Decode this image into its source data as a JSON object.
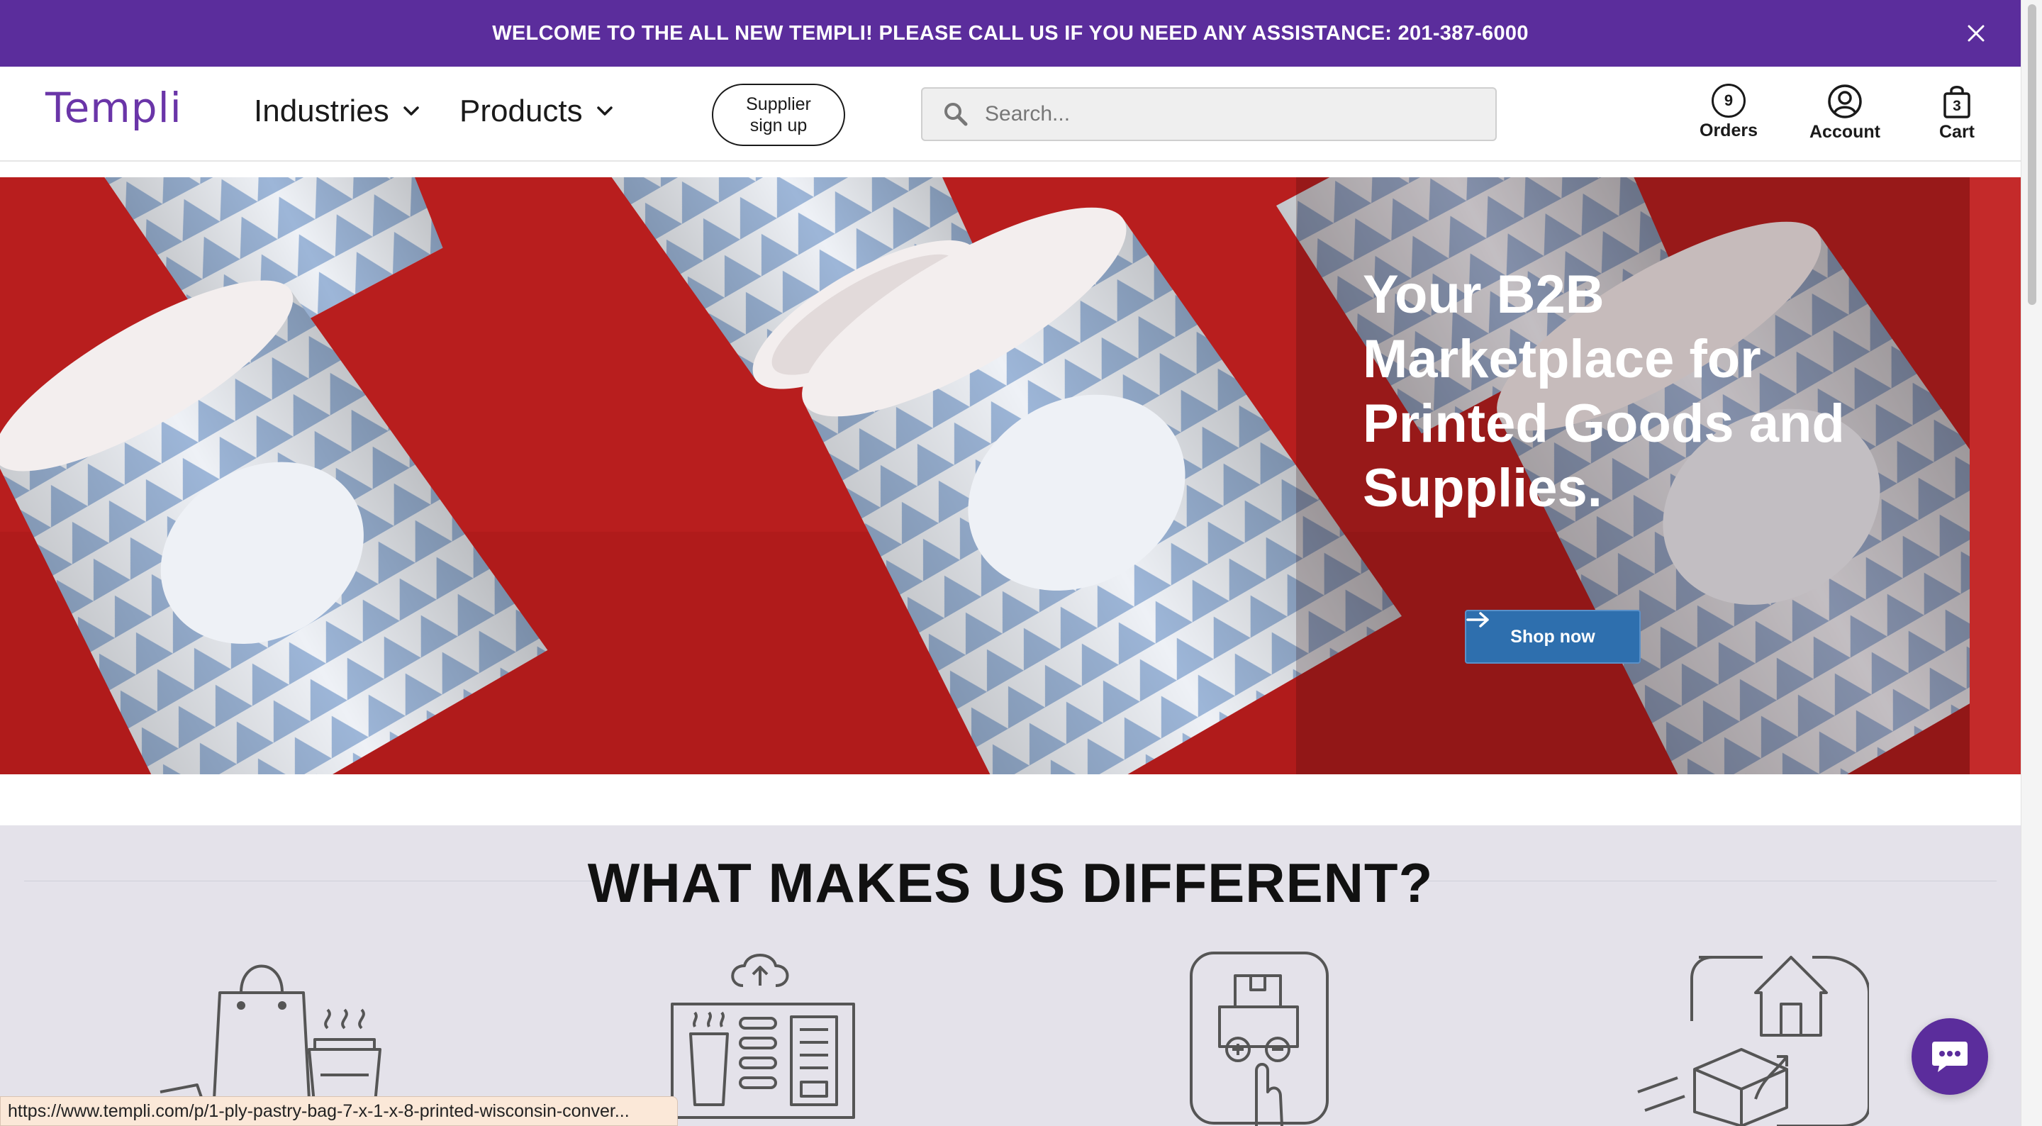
{
  "announcement": {
    "text": "WELCOME TO THE ALL NEW TEMPLI! PLEASE CALL US IF YOU NEED ANY ASSISTANCE: 201-387-6000",
    "close_icon": "close-icon"
  },
  "header": {
    "logo": "Templi",
    "nav": [
      {
        "label": "Industries",
        "icon": "chevron-down-icon"
      },
      {
        "label": "Products",
        "icon": "chevron-down-icon"
      }
    ],
    "supplier_button": "Supplier sign up",
    "search": {
      "placeholder": "Search...",
      "value": "",
      "icon": "search-icon"
    },
    "orders": {
      "label": "Orders",
      "count": "9"
    },
    "account": {
      "label": "Account"
    },
    "cart": {
      "label": "Cart",
      "count": "3"
    }
  },
  "hero": {
    "title": "Your B2B Marketplace for Printed Goods and Supplies.",
    "button": "Shop now",
    "colors": {
      "background": "#b81e1e",
      "cup_pattern": "#9db6d8",
      "button": "#2e6fae"
    }
  },
  "different": {
    "title": "WHAT MAKES US DIFFERENT?",
    "icons": [
      "shopping-bag-coffee-icon",
      "cloud-upload-catalog-icon",
      "order-quantity-touch-icon",
      "delivery-home-icon"
    ]
  },
  "status_bar": {
    "url": "https://www.templi.com/p/1-ply-pastry-bag-7-x-1-x-8-printed-wisconsin-conver..."
  },
  "chat": {
    "icon": "chat-bubble-icon"
  },
  "colors": {
    "brand": "#5b2d9c",
    "announcement_bg": "#5b2d9c",
    "section_bg": "#e4e2ea"
  }
}
